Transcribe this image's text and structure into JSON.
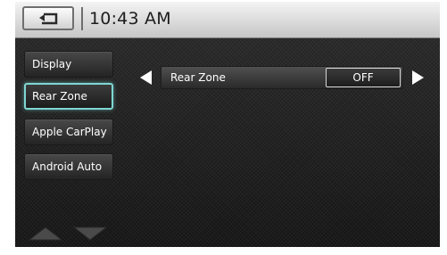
{
  "header": {
    "time": "10:43 AM",
    "back_icon": "back-return-icon"
  },
  "sidebar": {
    "items": [
      {
        "label": "Display",
        "active": false
      },
      {
        "label": "Rear Zone",
        "active": true
      },
      {
        "label": "Apple CarPlay",
        "active": false
      },
      {
        "label": "Android Auto",
        "active": false
      }
    ],
    "scroll_up_icon": "chevron-up-icon",
    "scroll_down_icon": "chevron-down-icon"
  },
  "setting": {
    "label": "Rear Zone",
    "value": "OFF",
    "prev_icon": "triangle-left-icon",
    "next_icon": "triangle-right-icon"
  },
  "colors": {
    "active_outline": "#7fd6d2",
    "header_bg": "#d9d9d9",
    "panel_bg": "#1e1e1e"
  }
}
